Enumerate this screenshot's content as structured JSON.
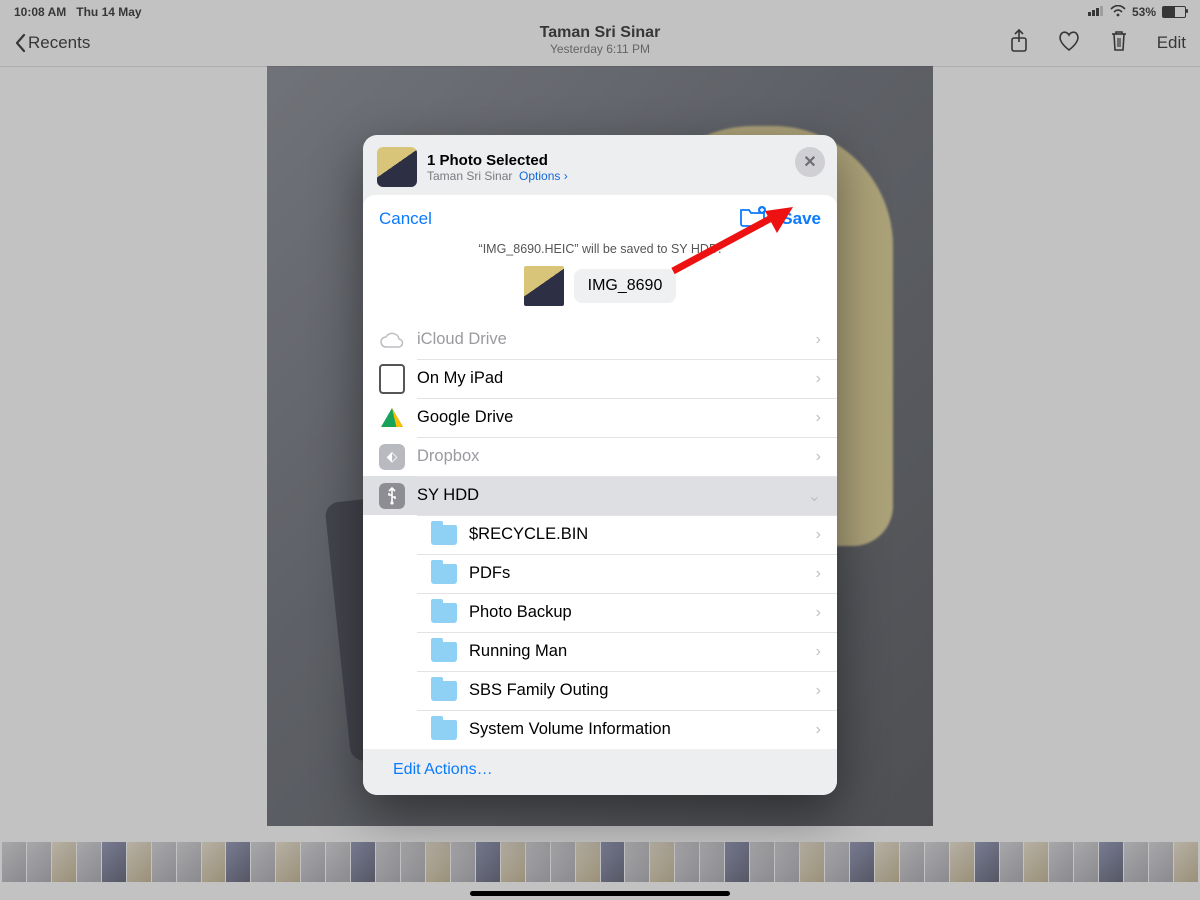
{
  "status": {
    "time": "10:08 AM",
    "date": "Thu 14 May",
    "battery": "53%"
  },
  "nav": {
    "back": "Recents",
    "title": "Taman Sri Sinar",
    "subtitle": "Yesterday  6:11 PM",
    "edit": "Edit"
  },
  "share_header": {
    "title": "1 Photo Selected",
    "subtitle": "Taman Sri Sinar",
    "options": "Options",
    "close": "✕"
  },
  "save_panel": {
    "cancel": "Cancel",
    "save": "Save",
    "hint": "“IMG_8690.HEIC” will be saved to SY HDD.",
    "filename": "IMG_8690"
  },
  "locations": {
    "icloud": "iCloud Drive",
    "ipad": "On My iPad",
    "gdrive": "Google Drive",
    "dropbox": "Dropbox",
    "syhdd": "SY HDD"
  },
  "folders": [
    "$RECYCLE.BIN",
    "PDFs",
    "Photo Backup",
    "Running Man",
    "SBS Family Outing",
    "System Volume Information"
  ],
  "edit_actions": "Edit Actions…",
  "glyph": {
    "chevr": "›",
    "chevd": "⌄",
    "chevl": "‹"
  }
}
